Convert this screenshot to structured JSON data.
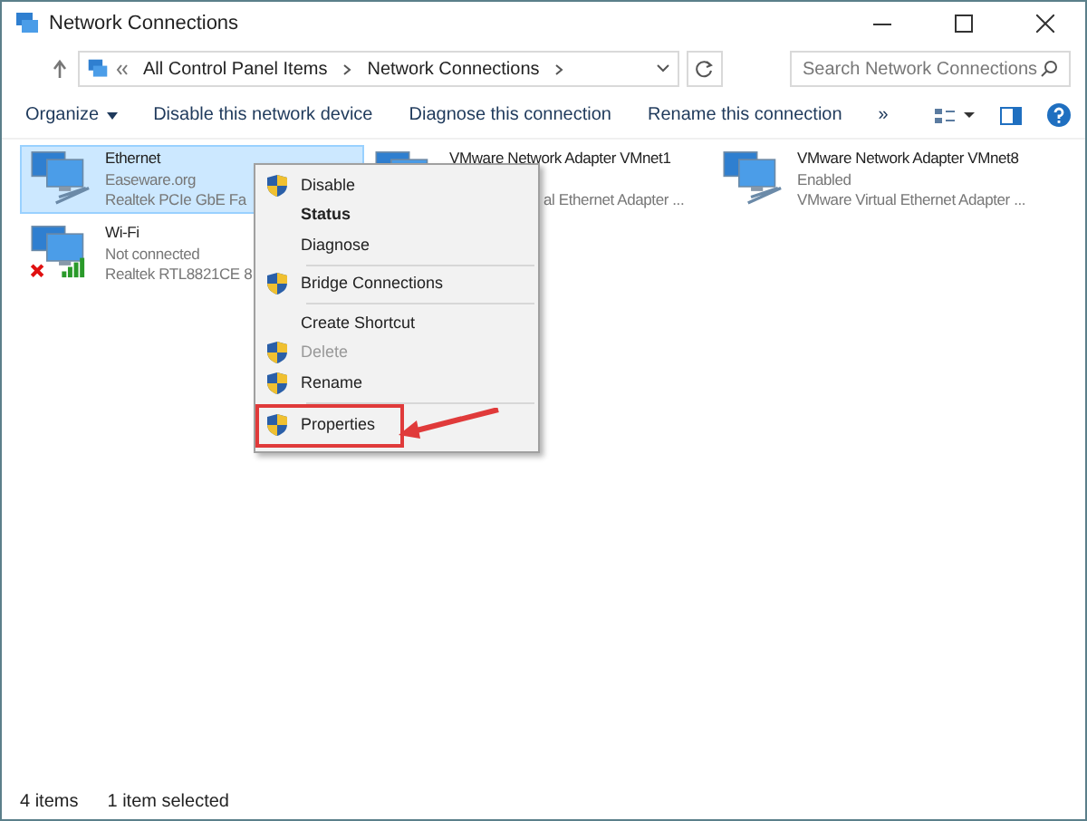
{
  "window": {
    "title": "Network Connections"
  },
  "address_bar": {
    "breadcrumbs": [
      "All Control Panel Items",
      "Network Connections"
    ]
  },
  "search": {
    "placeholder": "Search Network Connections"
  },
  "toolbar": {
    "organize": "Organize",
    "actions": [
      "Disable this network device",
      "Diagnose this connection",
      "Rename this connection"
    ],
    "more": "»"
  },
  "connections": [
    {
      "name": "Ethernet",
      "status": "Easeware.org",
      "device": "Realtek PCIe GbE Fa",
      "selected": true,
      "kind": "wired"
    },
    {
      "name": "VMware Network Adapter VMnet1",
      "device": "al Ethernet Adapter ...",
      "selected": false,
      "kind": "wired"
    },
    {
      "name": "VMware Network Adapter VMnet8",
      "status": "Enabled",
      "device": "VMware Virtual Ethernet Adapter ...",
      "selected": false,
      "kind": "wired"
    },
    {
      "name": "Wi-Fi",
      "status": "Not connected",
      "device": "Realtek RTL8821CE 8",
      "selected": false,
      "kind": "wireless-off"
    }
  ],
  "context_menu": [
    {
      "kind": "item",
      "label": "Disable",
      "shield": true,
      "bold": false,
      "disabled": false
    },
    {
      "kind": "item",
      "label": "Status",
      "shield": false,
      "bold": true,
      "disabled": false
    },
    {
      "kind": "item",
      "label": "Diagnose",
      "shield": false,
      "bold": false,
      "disabled": false
    },
    {
      "kind": "separator"
    },
    {
      "kind": "item",
      "label": "Bridge Connections",
      "shield": true,
      "bold": false,
      "disabled": false
    },
    {
      "kind": "separator"
    },
    {
      "kind": "item",
      "label": "Create Shortcut",
      "shield": false,
      "bold": false,
      "disabled": false
    },
    {
      "kind": "item",
      "label": "Delete",
      "shield": true,
      "bold": false,
      "disabled": true
    },
    {
      "kind": "item",
      "label": "Rename",
      "shield": true,
      "bold": false,
      "disabled": false
    },
    {
      "kind": "separator"
    },
    {
      "kind": "item",
      "label": "Properties",
      "shield": true,
      "bold": false,
      "disabled": false,
      "highlighted": true
    }
  ],
  "status_bar": {
    "count": "4 items",
    "selection": "1 item selected"
  }
}
